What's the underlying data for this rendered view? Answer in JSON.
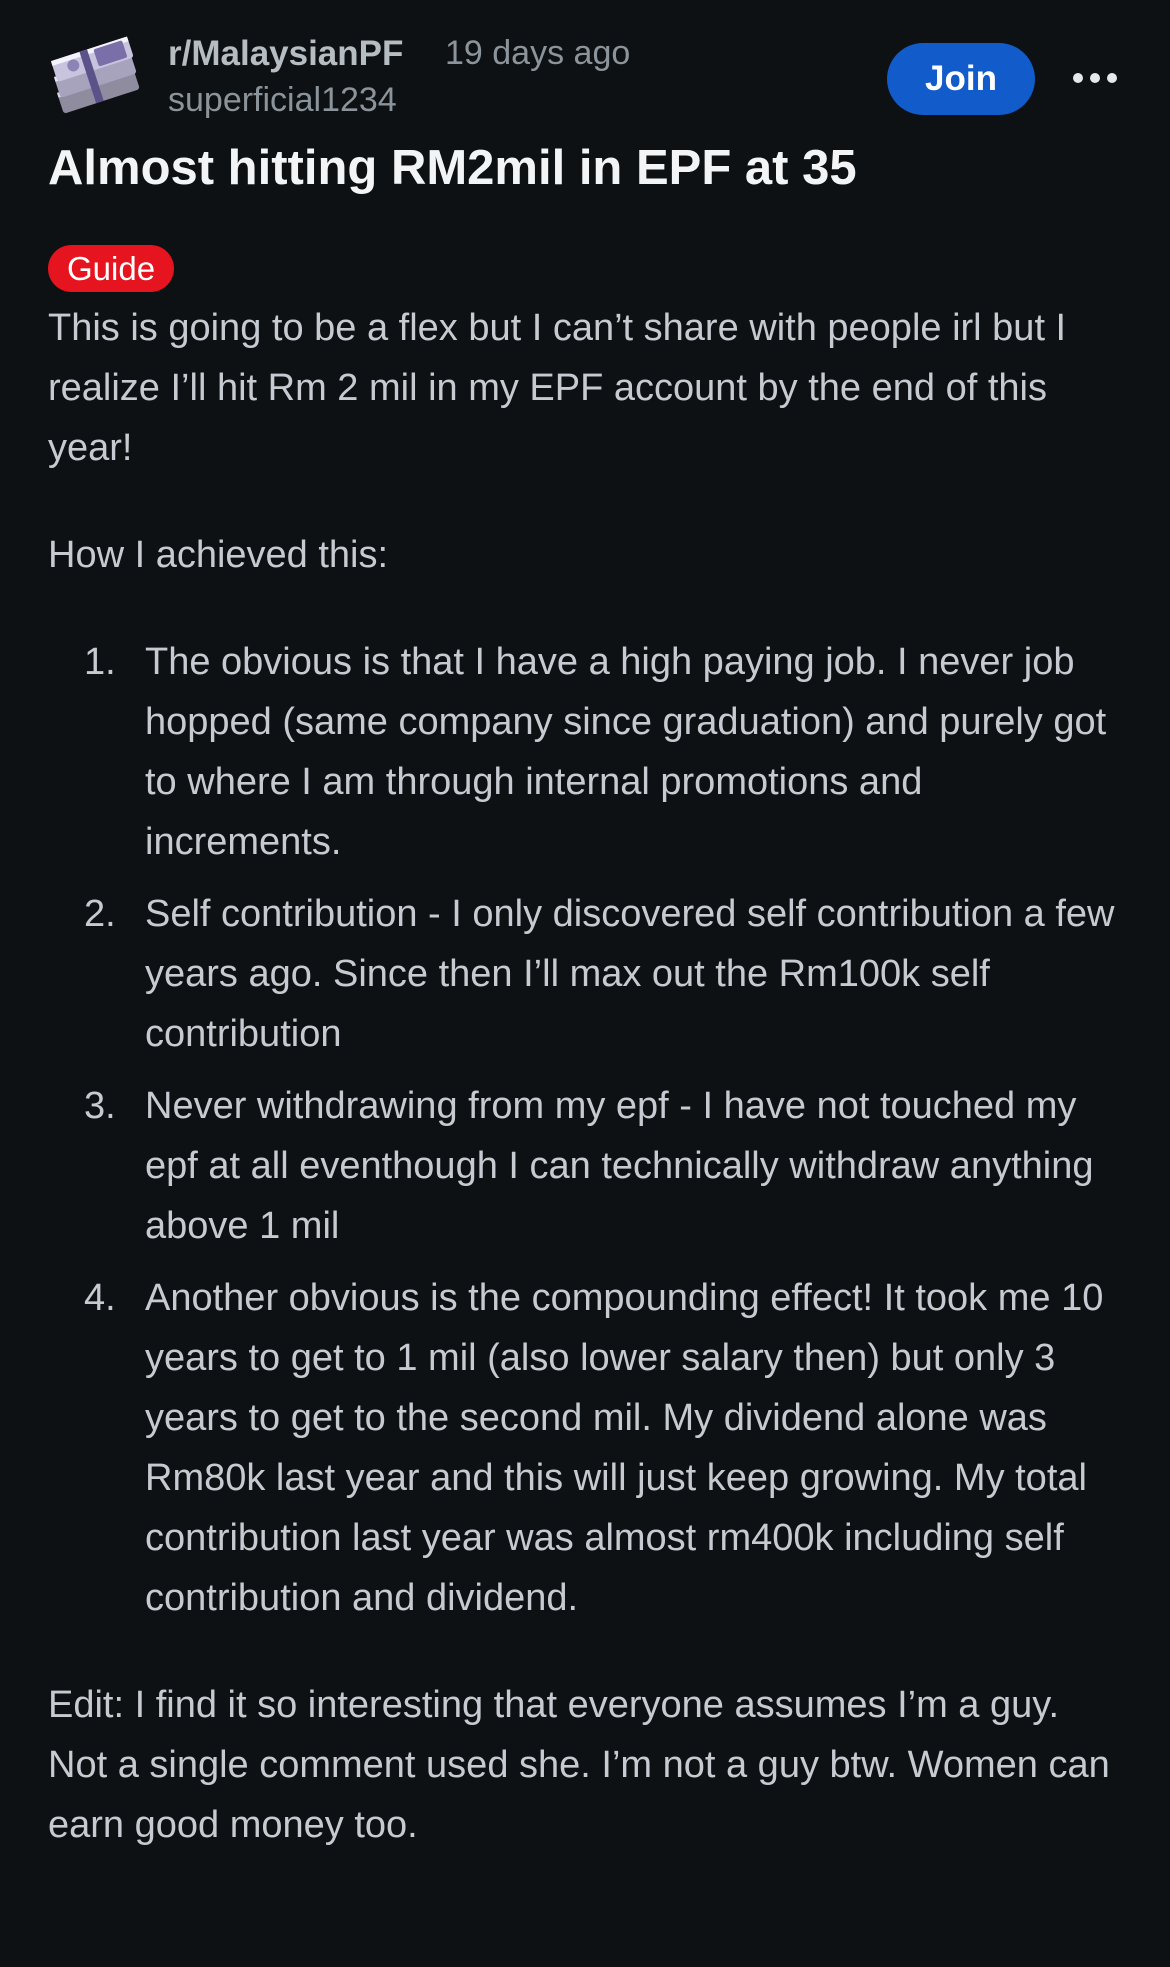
{
  "header": {
    "subreddit": "r/MalaysianPF",
    "time_ago": "19 days ago",
    "author": "superficial1234",
    "join_label": "Join",
    "avatar_icon": "money-stack-icon",
    "more_icon": "more-options-icon"
  },
  "post": {
    "title": "Almost hitting RM2mil in EPF at 35",
    "flair": "Guide",
    "flair_color": "#e5141f",
    "intro": "This is going to be a flex but I can’t share with people irl but I realize I’ll hit Rm 2 mil in my EPF account by the end of this year!",
    "how": "How I achieved this:",
    "list": [
      {
        "num": "1.",
        "text": "The obvious is that I have a high paying job. I never job hopped (same company since graduation) and purely got to where I am through internal promotions and increments."
      },
      {
        "num": "2.",
        "text": "Self contribution - I only discovered self contribution a few years ago. Since then I’ll max out the Rm100k self contribution"
      },
      {
        "num": "3.",
        "text": "Never withdrawing from my epf - I have not touched my epf at all eventhough I can technically withdraw anything above 1 mil"
      },
      {
        "num": "4.",
        "text": "Another obvious is the compounding effect! It took me 10 years to get to 1 mil (also lower salary then) but only 3 years to get to the second mil. My dividend alone was Rm80k last year and this will just keep growing. My total contribution last year was almost rm400k including self contribution and dividend."
      }
    ],
    "edit": "Edit: I find it so interesting that everyone assumes I’m a guy. Not a single comment used she. I’m not a guy btw. Women can earn good money too."
  },
  "colors": {
    "background": "#0e1113",
    "join_button": "#115bca",
    "title_text": "#f2f4f5",
    "body_text": "#c5cbd0",
    "meta_text": "#8b949b"
  }
}
